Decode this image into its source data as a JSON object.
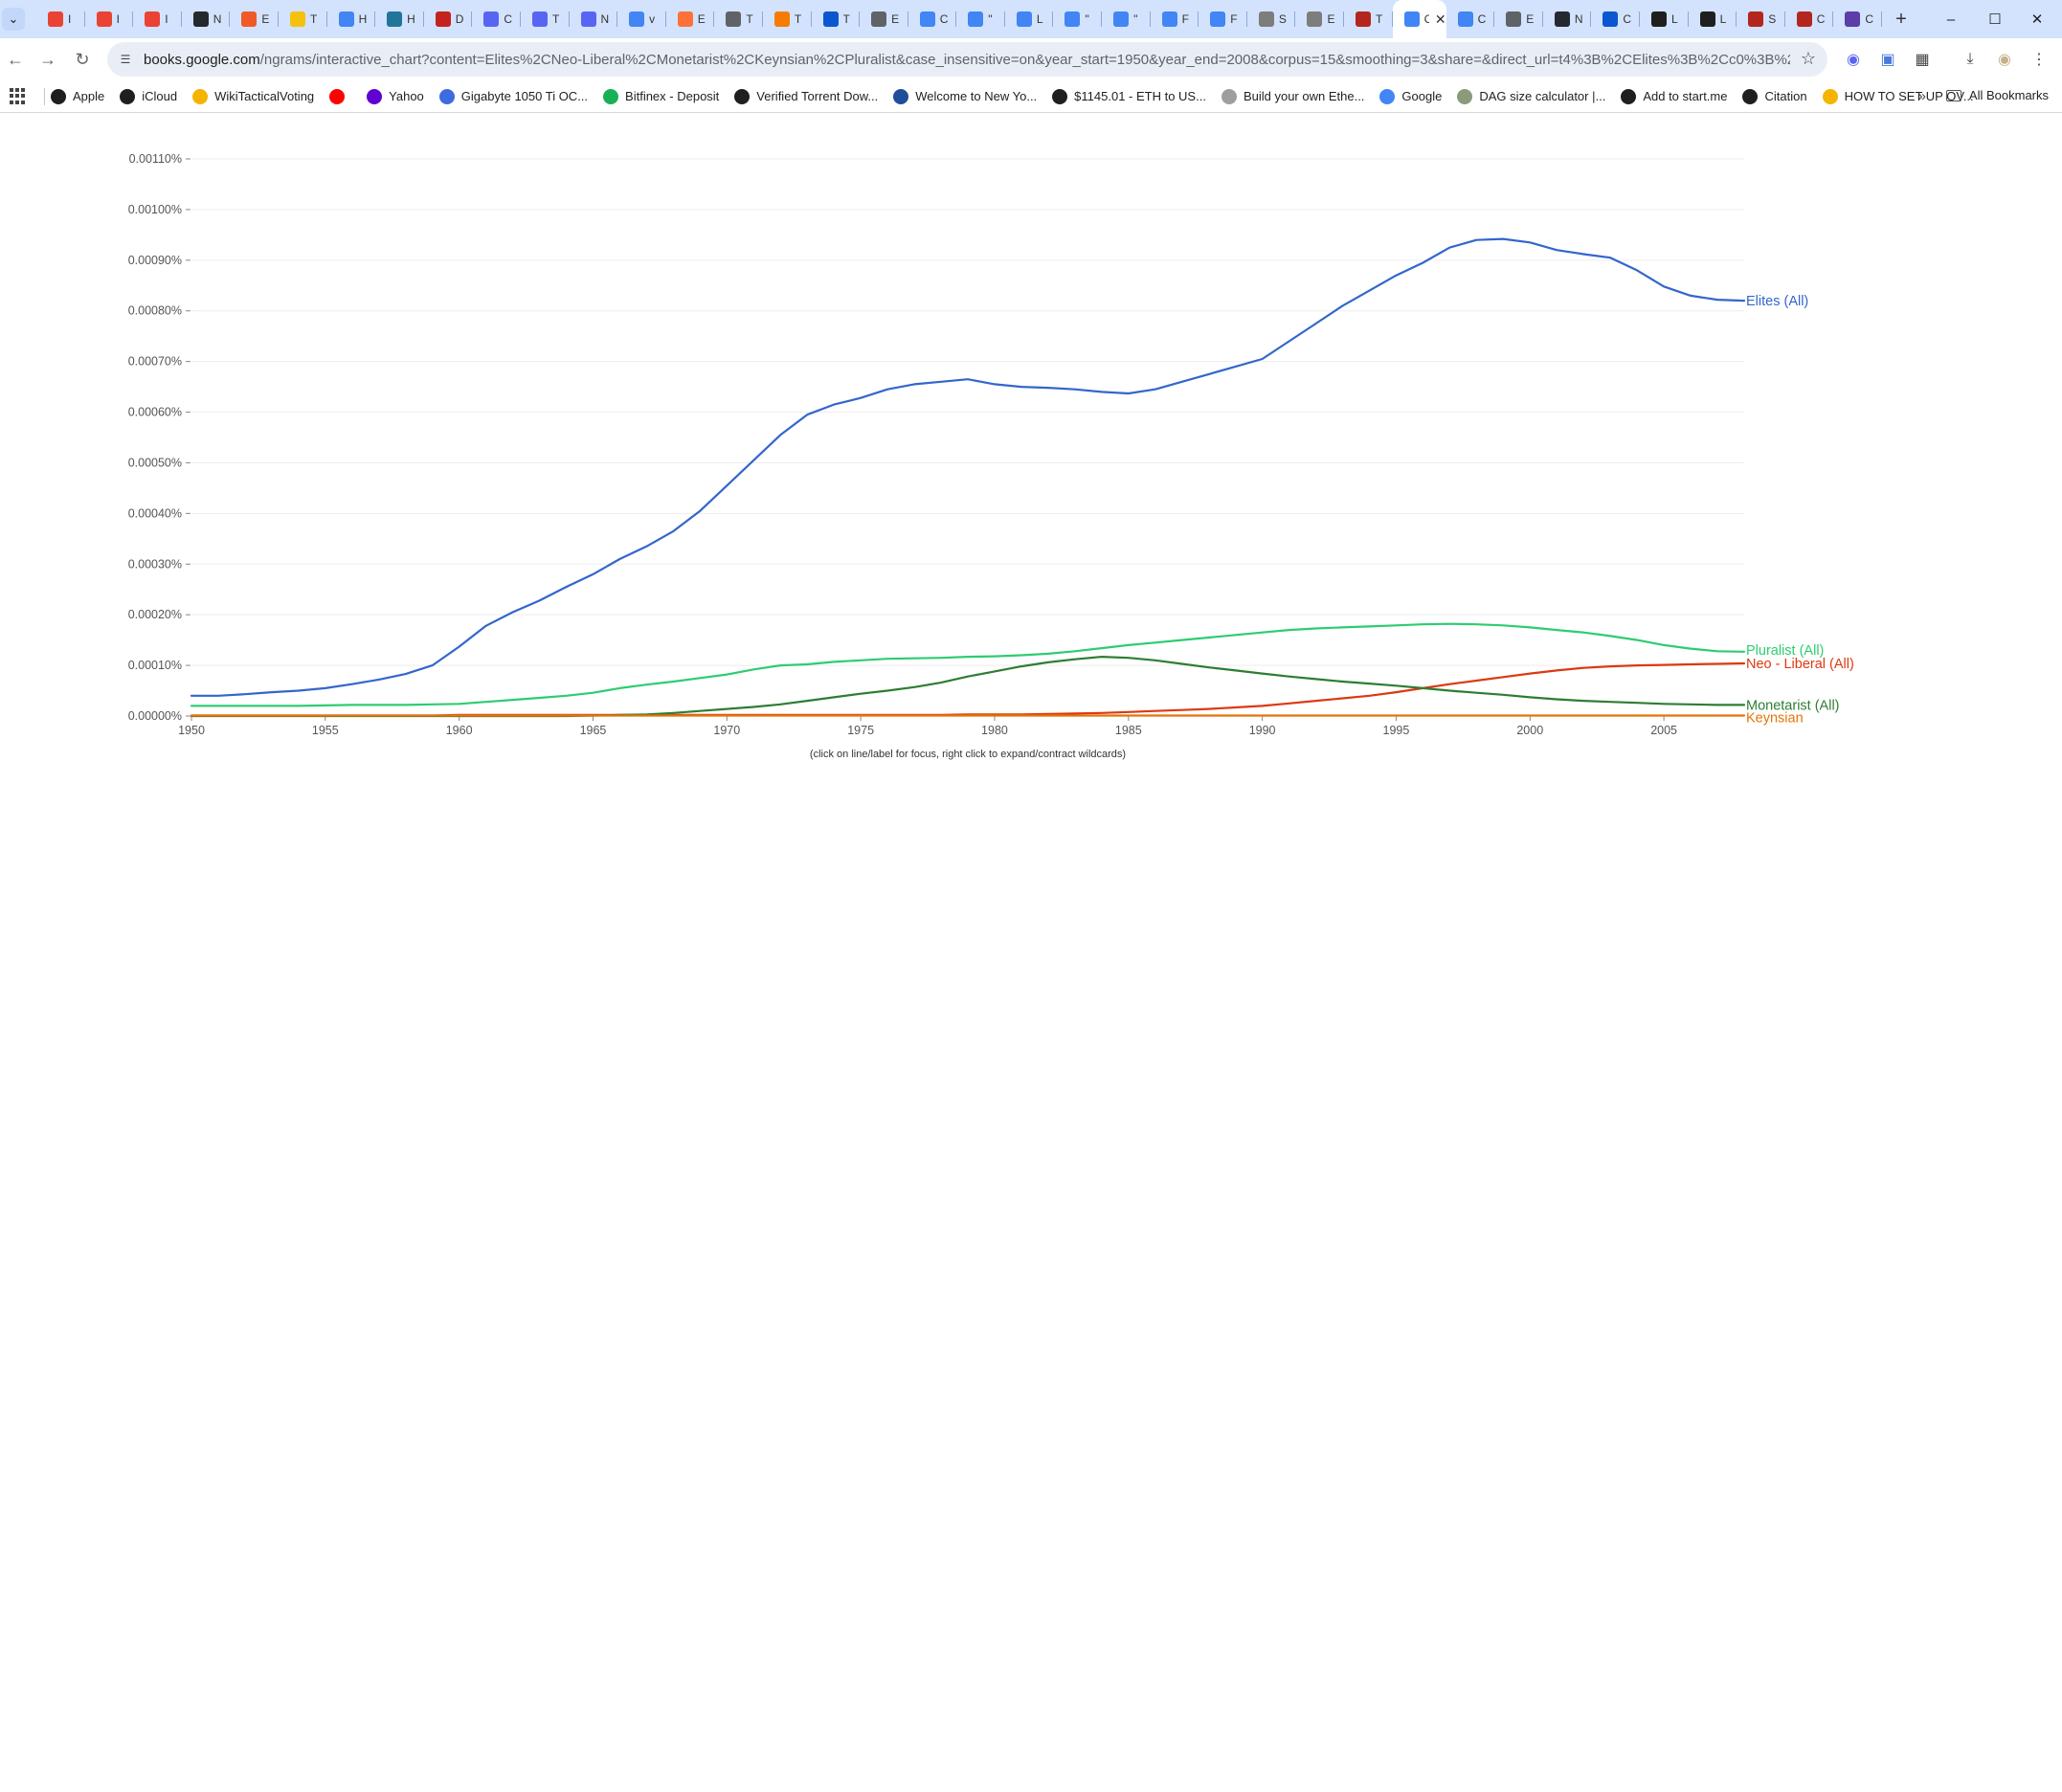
{
  "browser": {
    "tabs": [
      {
        "icon": "gmail-icon",
        "color": "#ea4335",
        "text": "I"
      },
      {
        "icon": "gmail-icon",
        "color": "#ea4335",
        "text": "I"
      },
      {
        "icon": "gmail-icon",
        "color": "#ea4335",
        "text": "I"
      },
      {
        "icon": "github-icon",
        "color": "#24292f",
        "text": "N"
      },
      {
        "icon": "bookmark-icon",
        "color": "#f05a28",
        "text": "E"
      },
      {
        "icon": "pencil-icon",
        "color": "#f4c20d",
        "text": "T"
      },
      {
        "icon": "google-icon",
        "color": "#4285f4",
        "text": "H"
      },
      {
        "icon": "wordpress-icon",
        "color": "#21759b",
        "text": "H"
      },
      {
        "icon": "calendar-icon",
        "color": "#c5221f",
        "text": "D"
      },
      {
        "icon": "discord-icon",
        "color": "#5865f2",
        "text": "C"
      },
      {
        "icon": "discord-icon",
        "color": "#5865f2",
        "text": "T"
      },
      {
        "icon": "discord-icon",
        "color": "#5865f2",
        "text": "N"
      },
      {
        "icon": "google-icon",
        "color": "#4285f4",
        "text": "v"
      },
      {
        "icon": "firefox-icon",
        "color": "#ff7139",
        "text": "E"
      },
      {
        "icon": "globe-icon",
        "color": "#5f6368",
        "text": "T"
      },
      {
        "icon": "orange-icon",
        "color": "#f57c00",
        "text": "T"
      },
      {
        "icon": "site-icon",
        "color": "#0b57d0",
        "text": "T"
      },
      {
        "icon": "globe-icon",
        "color": "#5f6368",
        "text": "E"
      },
      {
        "icon": "google-icon",
        "color": "#4285f4",
        "text": "C"
      },
      {
        "icon": "google-icon",
        "color": "#4285f4",
        "text": "\""
      },
      {
        "icon": "google-icon",
        "color": "#4285f4",
        "text": "L"
      },
      {
        "icon": "google-icon",
        "color": "#4285f4",
        "text": "\""
      },
      {
        "icon": "google-icon",
        "color": "#4285f4",
        "text": "\""
      },
      {
        "icon": "google-icon",
        "color": "#4285f4",
        "text": "F"
      },
      {
        "icon": "google-icon",
        "color": "#4285f4",
        "text": "F"
      },
      {
        "icon": "site-icon",
        "color": "#7d7d7d",
        "text": "S"
      },
      {
        "icon": "site-icon",
        "color": "#7d7d7d",
        "text": "E"
      },
      {
        "icon": "site-icon",
        "color": "#b3261e",
        "text": "T"
      },
      {
        "icon": "ngram-icon",
        "color": "#4285f4",
        "text": "C",
        "active": true
      },
      {
        "icon": "google-icon",
        "color": "#4285f4",
        "text": "C"
      },
      {
        "icon": "globe-icon",
        "color": "#5f6368",
        "text": "E"
      },
      {
        "icon": "github-icon",
        "color": "#24292f",
        "text": "N"
      },
      {
        "icon": "diamond-icon",
        "color": "#0b57d0",
        "text": "C"
      },
      {
        "icon": "site-icon",
        "color": "#1f1f1f",
        "text": "L"
      },
      {
        "icon": "site-icon",
        "color": "#1f1f1f",
        "text": "L"
      },
      {
        "icon": "site-icon",
        "color": "#b3261e",
        "text": "S"
      },
      {
        "icon": "site-icon",
        "color": "#b3261e",
        "text": "C"
      },
      {
        "icon": "calendar-icon",
        "color": "#5b3ea8",
        "text": "C"
      }
    ],
    "url_host": "books.google.com",
    "url_rest": "/ngrams/interactive_chart?content=Elites%2CNeo-Liberal%2CMonetarist%2CKeynsian%2CPluralist&case_insensitive=on&year_start=1950&year_end=2008&corpus=15&smoothing=3&share=&direct_url=t4%3B%2CElites%3B%2Cc0%3B%2Cs0%3B%3Belites%...",
    "bookmarks": [
      {
        "label": "Apple",
        "icon": "globe-icon",
        "color": "#1f1f1f"
      },
      {
        "label": "iCloud",
        "icon": "globe-icon",
        "color": "#1f1f1f"
      },
      {
        "label": "WikiTacticalVoting",
        "icon": "star-icon",
        "color": "#f4b400"
      },
      {
        "label": "",
        "icon": "youtube-icon",
        "color": "#ff0000"
      },
      {
        "label": "Yahoo",
        "icon": "yahoo-icon",
        "color": "#6001d2"
      },
      {
        "label": "Gigabyte 1050 Ti OC...",
        "icon": "triangle-icon",
        "color": "#3d6be0"
      },
      {
        "label": "Bitfinex - Deposit",
        "icon": "leaf-icon",
        "color": "#16b157"
      },
      {
        "label": "Verified Torrent Dow...",
        "icon": "globe-icon",
        "color": "#1f1f1f"
      },
      {
        "label": "Welcome to New Yo...",
        "icon": "s-icon",
        "color": "#1f4e9b"
      },
      {
        "label": "$1145.01 - ETH to US...",
        "icon": "globe-icon",
        "color": "#1f1f1f"
      },
      {
        "label": "Build your own Ethe...",
        "icon": "robot-icon",
        "color": "#9e9e9e"
      },
      {
        "label": "Google",
        "icon": "google-icon",
        "color": "#4285f4"
      },
      {
        "label": "DAG size calculator |...",
        "icon": "moon-icon",
        "color": "#8a9a7b"
      },
      {
        "label": "Add to start.me",
        "icon": "globe-icon",
        "color": "#1f1f1f"
      },
      {
        "label": "Citation",
        "icon": "globe-icon",
        "color": "#1f1f1f"
      },
      {
        "label": "HOW TO SET UP OV...",
        "icon": "coin-icon",
        "color": "#f4b400"
      }
    ],
    "all_bookmarks_label": "All Bookmarks"
  },
  "chart_data": {
    "type": "line",
    "title": "",
    "xlabel": "",
    "ylabel": "",
    "xlim": [
      1950,
      2008
    ],
    "ylim": [
      0,
      0.0011
    ],
    "x_ticks": [
      "1950",
      "1955",
      "1960",
      "1965",
      "1970",
      "1975",
      "1980",
      "1985",
      "1990",
      "1995",
      "2000",
      "2005"
    ],
    "y_ticks": [
      "0.00000%",
      "0.00010%",
      "0.00020%",
      "0.00030%",
      "0.00040%",
      "0.00050%",
      "0.00060%",
      "0.00070%",
      "0.00080%",
      "0.00090%",
      "0.00100%",
      "0.00110%"
    ],
    "grid": "horizontal",
    "legend": "right-end-labels",
    "x": [
      1950,
      1951,
      1952,
      1953,
      1954,
      1955,
      1956,
      1957,
      1958,
      1959,
      1960,
      1961,
      1962,
      1963,
      1964,
      1965,
      1966,
      1967,
      1968,
      1969,
      1970,
      1971,
      1972,
      1973,
      1974,
      1975,
      1976,
      1977,
      1978,
      1979,
      1980,
      1981,
      1982,
      1983,
      1984,
      1985,
      1986,
      1987,
      1988,
      1989,
      1990,
      1991,
      1992,
      1993,
      1994,
      1995,
      1996,
      1997,
      1998,
      1999,
      2000,
      2001,
      2002,
      2003,
      2004,
      2005,
      2006,
      2007,
      2008
    ],
    "series": [
      {
        "name": "Elites (All)",
        "color": "#3366cc",
        "values": [
          4e-05,
          4e-05,
          4.3e-05,
          4.7e-05,
          5e-05,
          5.5e-05,
          6.3e-05,
          7.2e-05,
          8.3e-05,
          0.0001,
          0.000137,
          0.000178,
          0.000205,
          0.000228,
          0.000255,
          0.00028,
          0.00031,
          0.000335,
          0.000365,
          0.000405,
          0.000455,
          0.000505,
          0.000555,
          0.000595,
          0.000615,
          0.000628,
          0.000645,
          0.000655,
          0.00066,
          0.000665,
          0.000655,
          0.00065,
          0.000648,
          0.000645,
          0.00064,
          0.000637,
          0.000645,
          0.00066,
          0.000675,
          0.00069,
          0.000705,
          0.00074,
          0.000775,
          0.00081,
          0.00084,
          0.00087,
          0.000895,
          0.000925,
          0.00094,
          0.000942,
          0.000935,
          0.00092,
          0.000912,
          0.000905,
          0.00088,
          0.000848,
          0.00083,
          0.000822,
          0.00082
        ]
      },
      {
        "name": "Pluralist (All)",
        "color": "#109618",
        "lineColor": "#2ecc71",
        "values": [
          2e-05,
          2e-05,
          2e-05,
          2e-05,
          2e-05,
          2.1e-05,
          2.2e-05,
          2.2e-05,
          2.2e-05,
          2.3e-05,
          2.4e-05,
          2.8e-05,
          3.2e-05,
          3.6e-05,
          4e-05,
          4.6e-05,
          5.5e-05,
          6.2e-05,
          6.8e-05,
          7.5e-05,
          8.2e-05,
          9.2e-05,
          0.0001,
          0.000102,
          0.000107,
          0.00011,
          0.000113,
          0.000114,
          0.000115,
          0.000117,
          0.000118,
          0.00012,
          0.000123,
          0.000128,
          0.000134,
          0.00014,
          0.000145,
          0.00015,
          0.000155,
          0.00016,
          0.000165,
          0.00017,
          0.000173,
          0.000175,
          0.000177,
          0.000179,
          0.000181,
          0.000182,
          0.000181,
          0.000179,
          0.000175,
          0.00017,
          0.000165,
          0.000158,
          0.00015,
          0.00014,
          0.000133,
          0.000128,
          0.000127
        ]
      },
      {
        "name": "Neo - Liberal (All)",
        "color": "#dc3912",
        "values": [
          1e-06,
          1e-06,
          1e-06,
          1e-06,
          1e-06,
          1e-06,
          1e-06,
          1e-06,
          1e-06,
          1e-06,
          2e-06,
          2e-06,
          2e-06,
          2e-06,
          2e-06,
          2e-06,
          2e-06,
          2e-06,
          2e-06,
          2e-06,
          2e-06,
          2e-06,
          2e-06,
          2e-06,
          2e-06,
          2e-06,
          2e-06,
          2e-06,
          2e-06,
          3e-06,
          3e-06,
          3e-06,
          4e-06,
          5e-06,
          6e-06,
          8e-06,
          1e-05,
          1.2e-05,
          1.4e-05,
          1.7e-05,
          2e-05,
          2.5e-05,
          3e-05,
          3.5e-05,
          4e-05,
          4.7e-05,
          5.5e-05,
          6.3e-05,
          7e-05,
          7.7e-05,
          8.4e-05,
          9e-05,
          9.5e-05,
          9.8e-05,
          0.0001,
          0.000101,
          0.000102,
          0.000103,
          0.000104
        ]
      },
      {
        "name": "Monetarist (All)",
        "color": "#2e7d32",
        "values": [
          0.0,
          0.0,
          0.0,
          0.0,
          0.0,
          0.0,
          0.0,
          0.0,
          0.0,
          0.0,
          0.0,
          0.0,
          0.0,
          0.0,
          0.0,
          1e-06,
          2e-06,
          3e-06,
          6e-06,
          1e-05,
          1.4e-05,
          1.8e-05,
          2.3e-05,
          3e-05,
          3.7e-05,
          4.4e-05,
          5e-05,
          5.7e-05,
          6.6e-05,
          7.8e-05,
          8.8e-05,
          9.8e-05,
          0.000106,
          0.000112,
          0.000117,
          0.000115,
          0.00011,
          0.000103,
          9.6e-05,
          9e-05,
          8.4e-05,
          7.8e-05,
          7.3e-05,
          6.8e-05,
          6.4e-05,
          6e-05,
          5.5e-05,
          5e-05,
          4.6e-05,
          4.2e-05,
          3.7e-05,
          3.3e-05,
          3e-05,
          2.8e-05,
          2.6e-05,
          2.4e-05,
          2.3e-05,
          2.2e-05,
          2.2e-05
        ]
      },
      {
        "name": "Keynsian",
        "color": "#ff9900",
        "lineColor": "#e3740a",
        "values": [
          1e-06,
          1e-06,
          1e-06,
          1e-06,
          1e-06,
          1e-06,
          1e-06,
          1e-06,
          1e-06,
          1e-06,
          1e-06,
          1e-06,
          1e-06,
          1e-06,
          1e-06,
          1e-06,
          1e-06,
          1e-06,
          1e-06,
          1e-06,
          1e-06,
          1e-06,
          1e-06,
          1e-06,
          1e-06,
          1e-06,
          1e-06,
          1e-06,
          1e-06,
          1e-06,
          1e-06,
          1e-06,
          1e-06,
          1e-06,
          1e-06,
          1e-06,
          1e-06,
          1e-06,
          1e-06,
          1e-06,
          1e-06,
          1e-06,
          1e-06,
          1e-06,
          1e-06,
          1e-06,
          1e-06,
          1e-06,
          1e-06,
          1e-06,
          1e-06,
          1e-06,
          1e-06,
          1e-06,
          1e-06,
          1e-06,
          1e-06,
          1e-06,
          1e-06
        ]
      }
    ],
    "annotation": "(click on line/label for focus, right click to expand/contract wildcards)"
  }
}
